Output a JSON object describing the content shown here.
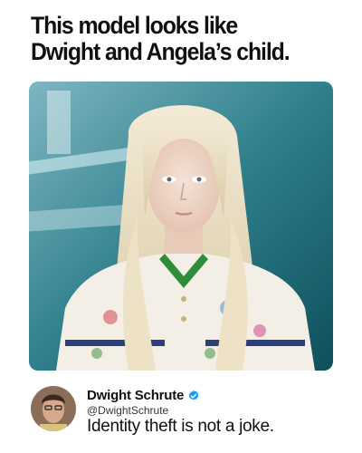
{
  "meme": {
    "headline_lines": [
      "This model looks like",
      "Dwight and Angela’s child."
    ]
  },
  "tweet": {
    "display_name": "Dwight Schrute",
    "handle": "@DwightSchrute",
    "text": "Identity theft is not a joke.",
    "verified": true,
    "verified_color": "#1d9bf0"
  }
}
